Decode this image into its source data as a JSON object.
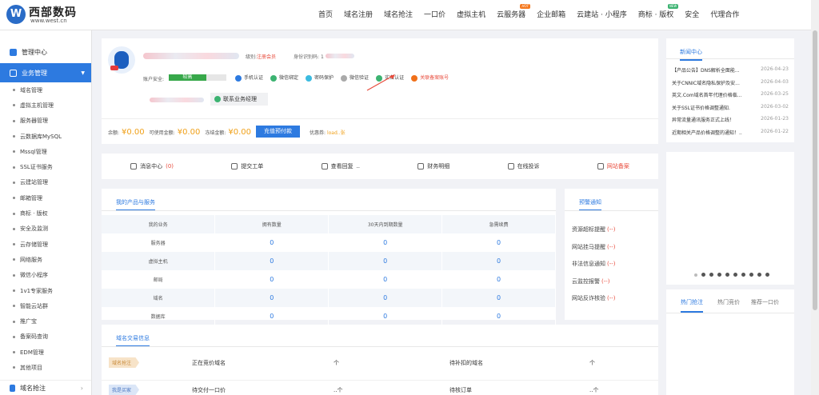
{
  "brand": {
    "logo_letter": "W",
    "name": "西部数码",
    "url": "www.west.cn"
  },
  "nav": [
    {
      "label": "首页"
    },
    {
      "label": "域名注册"
    },
    {
      "label": "域名抢注"
    },
    {
      "label": "一口价"
    },
    {
      "label": "虚拟主机"
    },
    {
      "label": "云服务器",
      "tag": "HOT"
    },
    {
      "label": "企业邮箱"
    },
    {
      "label": "云建站 · 小程序"
    },
    {
      "label": "商标 · 版权",
      "tag": "NEW"
    },
    {
      "label": "安全"
    },
    {
      "label": "代理合作"
    }
  ],
  "sidebar": {
    "top": "管理中心",
    "group": "业务管理",
    "items": [
      "域名管理",
      "虚拟主机管理",
      "服务器管理",
      "云数据库MySQL",
      "Mssql管理",
      "SSL证书服务",
      "云建站管理",
      "邮箱管理",
      "商标 · 版权",
      "安全及监测",
      "云存储管理",
      "网络服务",
      "微信小程序",
      "1v1专家服务",
      "智能云站群",
      "推广宝",
      "备案码查询",
      "EDM管理",
      "其他项目"
    ],
    "footer": "域名抢注"
  },
  "account": {
    "level_label": "级别:",
    "level_value": "注册会员",
    "id_label": "身份识别码:",
    "id_prefix": "1",
    "security_label": "账户安全:",
    "security_value": "较高",
    "security_level": 0.65,
    "checks": [
      {
        "label": "手机认证",
        "color": "#2d7ae0",
        "icon": "phone-icon"
      },
      {
        "label": "微信绑定",
        "color": "#3cb371",
        "icon": "wechat-icon"
      },
      {
        "label": "密码保护",
        "color": "#3bbbe0",
        "icon": "lock-icon"
      },
      {
        "label": "微信验证",
        "color": "#aaaaaa",
        "icon": "shield-icon"
      },
      {
        "label": "实名认证",
        "color": "#3cb371",
        "icon": "idcard-icon"
      },
      {
        "label": "关联备案账号",
        "color": "#f0701a",
        "icon": "link-icon"
      }
    ],
    "contact_button": "联系业务经理",
    "balance_label": "余额:",
    "balance_value": "¥0.00",
    "usable_label": "可使用金额:",
    "usable_value": "¥0.00",
    "frozen_label": "冻结金额:",
    "frozen_value": "¥0.00",
    "recharge_button": "充值预付款",
    "coupon_label": "优惠券:",
    "coupon_value": "load..张"
  },
  "quick": [
    {
      "label": "消息中心",
      "count": "(0)",
      "icon": "message-icon"
    },
    {
      "label": "提交工单",
      "icon": "edit-icon"
    },
    {
      "label": "查看回复",
      "suffix": " ..",
      "icon": "reply-icon"
    },
    {
      "label": "财务明细",
      "icon": "finance-icon"
    },
    {
      "label": "在线投诉",
      "icon": "complain-icon"
    },
    {
      "label": "网站备案",
      "icon": "record-icon"
    }
  ],
  "products": {
    "title": "我的产品与服务",
    "headers": [
      "我的业务",
      "拥有数量",
      "30天内到期数量",
      "急需续费"
    ],
    "rows": [
      {
        "name": "服务器",
        "c1": "0",
        "c2": "0",
        "c3": "0"
      },
      {
        "name": "虚拟主机",
        "c1": "0",
        "c2": "0",
        "c3": "0"
      },
      {
        "name": "邮局",
        "c1": "0",
        "c2": "0",
        "c3": "0"
      },
      {
        "name": "域名",
        "c1": "0",
        "c2": "0",
        "c3": "0"
      },
      {
        "name": "数据库",
        "c1": "0",
        "c2": "0",
        "c3": "0"
      }
    ]
  },
  "warnings": {
    "title": "预警通知",
    "items": [
      {
        "label": "资源超标提醒",
        "value": "(--)"
      },
      {
        "label": "网站挂马提醒",
        "value": "(--)"
      },
      {
        "label": "非法信息通知",
        "value": "(--)"
      },
      {
        "label": "云监控报警",
        "value": "(--)"
      },
      {
        "label": "网站反诈核验",
        "value": "(--)"
      }
    ]
  },
  "trade": {
    "title": "域名交易信息",
    "rows": [
      {
        "tag": "域名抢注",
        "tag_color": "#f7e3c8",
        "tag_text": "#c88a3a",
        "left": "正在竞价域名",
        "left_val": "个",
        "right": "待补扣的域名",
        "right_val": "个"
      },
      {
        "tag": "我是买家",
        "tag_color": "#dbe6f7",
        "tag_text": "#4a77c2",
        "left": "待交付一口价",
        "left_val": "..个",
        "right": "待核订单",
        "right_val": "..个"
      }
    ]
  },
  "news": {
    "title": "新闻中心",
    "items": [
      {
        "text": "【产品公告】DNS解析全面能...",
        "date": "2026-04-23"
      },
      {
        "text": "关于CNNIC域名隐私保护及安...",
        "date": "2026-04-03"
      },
      {
        "text": "英文.Com域名首年代理价格临...",
        "date": "2026-03-25"
      },
      {
        "text": "关于SSL证书价格调整通知.",
        "date": "2026-03-02"
      },
      {
        "text": "异常流量通讯服务正式上线！",
        "date": "2026-01-23"
      },
      {
        "text": "近期相关产品价格调整的通知！..",
        "date": "2026-01-22"
      }
    ]
  },
  "hot_tabs": [
    "热门抢注",
    "热门竞价",
    "推荐一口价"
  ]
}
